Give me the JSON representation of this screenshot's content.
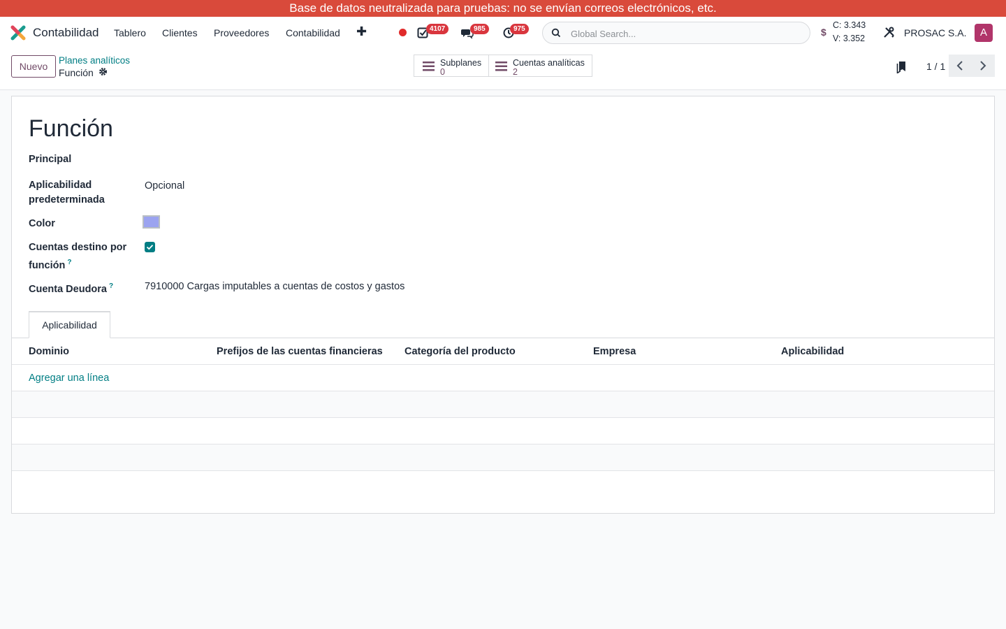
{
  "banner": {
    "text": "Base de datos neutralizada para pruebas: no se envían correos electrónicos, etc."
  },
  "navbar": {
    "app_name": "Contabilidad",
    "menu": [
      "Tablero",
      "Clientes",
      "Proveedores",
      "Contabilidad"
    ],
    "new_icon": "plus-icon",
    "badges": {
      "activities": "4107",
      "messages": "985",
      "timesheets": "975"
    },
    "search": {
      "placeholder": "Global Search..."
    },
    "currency": {
      "symbol": "$",
      "buy": "C: 3.343",
      "sell": "V: 3.352"
    },
    "company": "PROSAC S.A.",
    "avatar_letter": "A"
  },
  "control": {
    "new_button": "Nuevo",
    "breadcrumb_parent": "Planes analíticos",
    "breadcrumb_current": "Función",
    "smart_buttons": [
      {
        "label": "Subplanes",
        "count": "0"
      },
      {
        "label": "Cuentas analíticas",
        "count": "2"
      }
    ],
    "pager": "1 / 1"
  },
  "form": {
    "title": "Función",
    "subtitle": "Principal",
    "fields": {
      "applicability_label": "Aplicabilidad predeterminada",
      "applicability_value": "Opcional",
      "color_label": "Color",
      "color_value": "#9ba3f0",
      "per_function_label": "Cuentas destino por función",
      "per_function_checked": true,
      "debit_account_label": "Cuenta Deudora",
      "debit_account_value": "7910000 Cargas imputables a cuentas de costos y gastos"
    },
    "help_mark": "?",
    "tab": "Aplicabilidad",
    "table": {
      "columns": [
        "Dominio",
        "Prefijos de las cuentas financieras",
        "Categoría del producto",
        "Empresa",
        "Aplicabilidad"
      ],
      "add_line": "Agregar una línea"
    }
  },
  "colors": {
    "accent": "#714b67",
    "link": "#017e84",
    "banner": "#d94a3b",
    "badge": "#d9363e"
  }
}
